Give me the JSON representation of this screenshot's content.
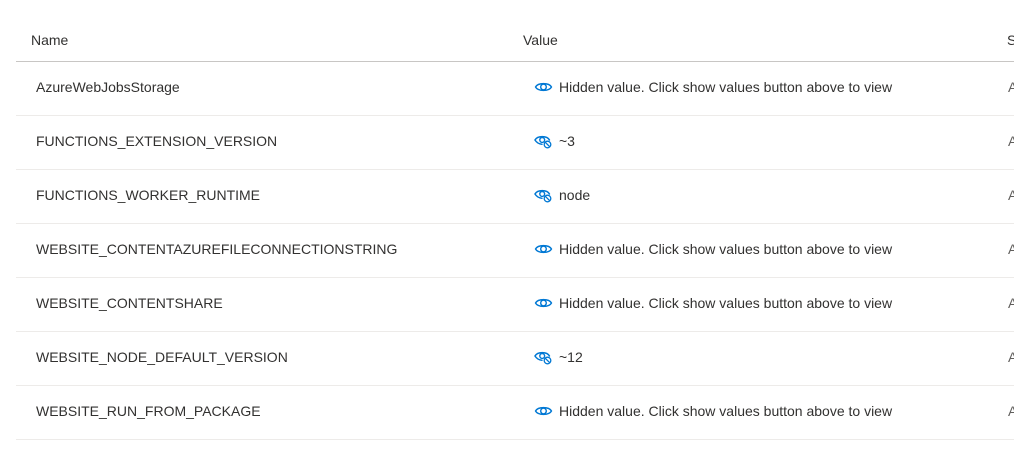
{
  "columns": {
    "name": "Name",
    "value": "Value",
    "source": "S"
  },
  "colors": {
    "icon_blue": "#0078d4",
    "header_border": "#c8c6c4",
    "row_border": "#edebe9"
  },
  "rows": [
    {
      "name": "AzureWebJobsStorage",
      "icon": "eye-icon",
      "value": "Hidden value. Click show values button above to view",
      "source": "A"
    },
    {
      "name": "FUNCTIONS_EXTENSION_VERSION",
      "icon": "eye-hide-icon",
      "value": "~3",
      "source": "A"
    },
    {
      "name": "FUNCTIONS_WORKER_RUNTIME",
      "icon": "eye-hide-icon",
      "value": "node",
      "source": "A"
    },
    {
      "name": "WEBSITE_CONTENTAZUREFILECONNECTIONSTRING",
      "icon": "eye-icon",
      "value": "Hidden value. Click show values button above to view",
      "source": "A"
    },
    {
      "name": "WEBSITE_CONTENTSHARE",
      "icon": "eye-icon",
      "value": "Hidden value. Click show values button above to view",
      "source": "A"
    },
    {
      "name": "WEBSITE_NODE_DEFAULT_VERSION",
      "icon": "eye-hide-icon",
      "value": "~12",
      "source": "A"
    },
    {
      "name": "WEBSITE_RUN_FROM_PACKAGE",
      "icon": "eye-icon",
      "value": "Hidden value. Click show values button above to view",
      "source": "A"
    }
  ]
}
